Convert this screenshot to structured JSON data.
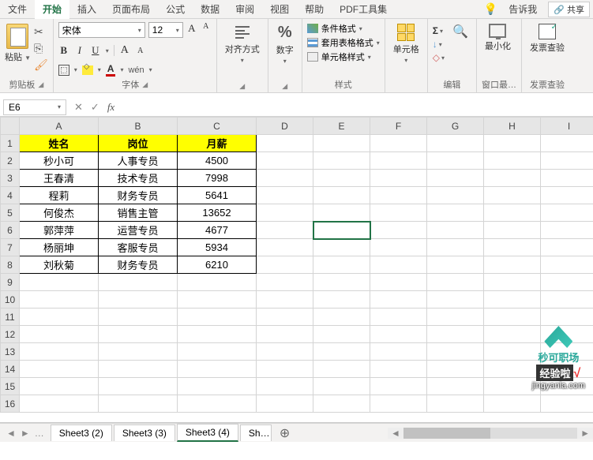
{
  "tabs": {
    "file": "文件",
    "home": "开始",
    "insert": "插入",
    "layout": "页面布局",
    "formulas": "公式",
    "data": "数据",
    "review": "审阅",
    "view": "视图",
    "help": "帮助",
    "pdf": "PDF工具集",
    "tellme": "告诉我",
    "share": "共享"
  },
  "ribbon": {
    "paste": "粘贴",
    "clipboard": "剪贴板",
    "font_name": "宋体",
    "font_size": "12",
    "font_group": "字体",
    "bold": "B",
    "italic": "I",
    "underline": "U",
    "font_color_letter": "A",
    "increase_font": "A",
    "decrease_font": "A",
    "wen": "wén",
    "align": "对齐方式",
    "number": "数字",
    "cond_format": "条件格式",
    "table_format": "套用表格格式",
    "cell_style": "单元格样式",
    "styles": "样式",
    "cells": "单元格",
    "editing": "编辑",
    "minimize": "最小化",
    "window": "窗口最…",
    "invoice": "发票查验",
    "invoice_group": "发票查验"
  },
  "formula_bar": {
    "cell_ref": "E6",
    "formula": ""
  },
  "columns": [
    "A",
    "B",
    "C",
    "D",
    "E",
    "F",
    "G",
    "H",
    "I"
  ],
  "headers": {
    "name": "姓名",
    "position": "岗位",
    "salary": "月薪"
  },
  "data_rows": [
    {
      "name": "秒小可",
      "position": "人事专员",
      "salary": "4500"
    },
    {
      "name": "王春清",
      "position": "技术专员",
      "salary": "7998"
    },
    {
      "name": "程莉",
      "position": "财务专员",
      "salary": "5641"
    },
    {
      "name": "何俊杰",
      "position": "销售主管",
      "salary": "13652"
    },
    {
      "name": "郭萍萍",
      "position": "运营专员",
      "salary": "4677"
    },
    {
      "name": "杨丽坤",
      "position": "客服专员",
      "salary": "5934"
    },
    {
      "name": "刘秋菊",
      "position": "财务专员",
      "salary": "6210"
    }
  ],
  "sheets": {
    "s1": "Sheet3 (2)",
    "s2": "Sheet3 (3)",
    "s3": "Sheet3 (4)",
    "s4": "Sh…"
  },
  "watermark": {
    "brand": "秒可职场",
    "exp": "经验啦",
    "host": "jingyanla.com"
  },
  "chart_data": {
    "type": "table",
    "columns": [
      "姓名",
      "岗位",
      "月薪"
    ],
    "rows": [
      [
        "秒小可",
        "人事专员",
        4500
      ],
      [
        "王春清",
        "技术专员",
        7998
      ],
      [
        "程莉",
        "财务专员",
        5641
      ],
      [
        "何俊杰",
        "销售主管",
        13652
      ],
      [
        "郭萍萍",
        "运营专员",
        4677
      ],
      [
        "杨丽坤",
        "客服专员",
        5934
      ],
      [
        "刘秋菊",
        "财务专员",
        6210
      ]
    ]
  }
}
